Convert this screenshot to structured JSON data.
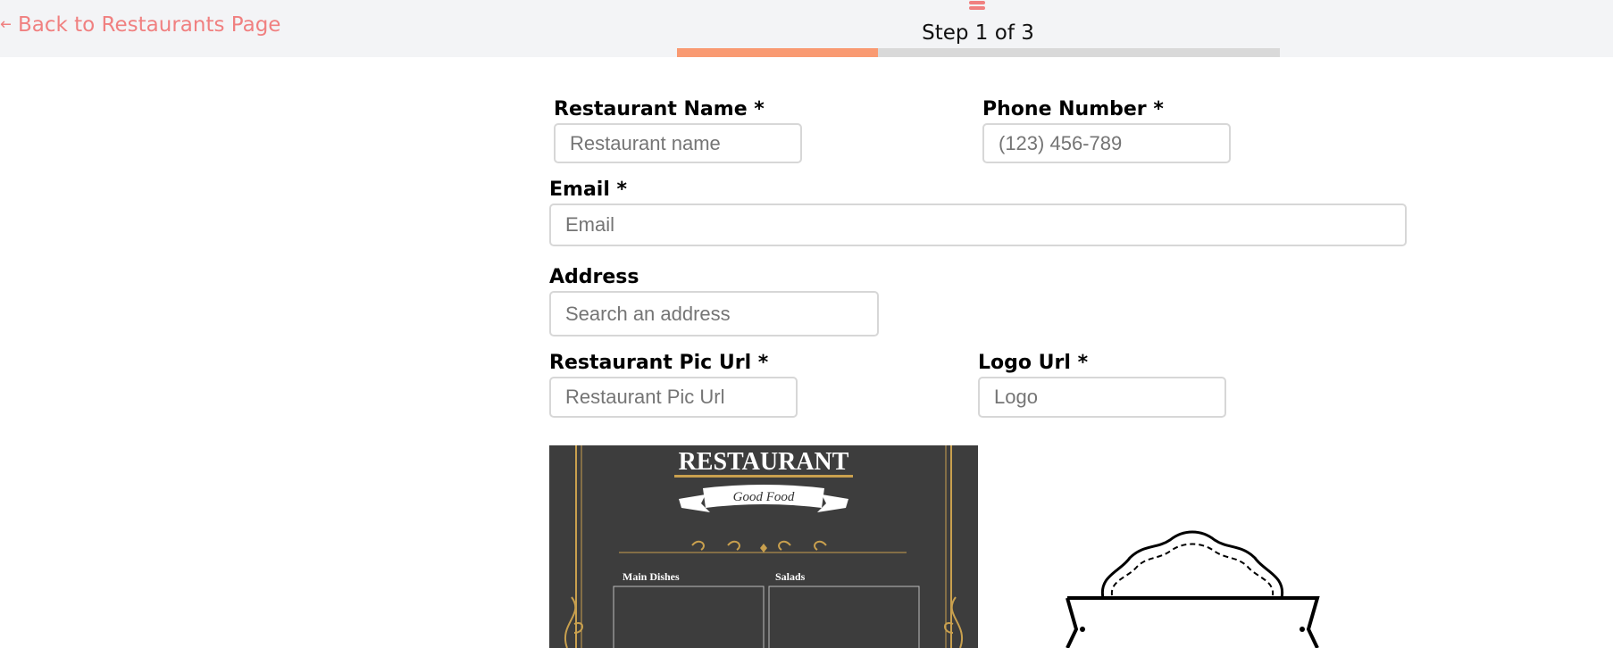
{
  "nav": {
    "back_label": "Back to Restaurants Page"
  },
  "progress": {
    "step_text": "Step 1 of 3",
    "fraction": 0.333
  },
  "form": {
    "name_label": "Restaurant Name *",
    "name_placeholder": "Restaurant name",
    "phone_label": "Phone Number *",
    "phone_placeholder": "(123) 456-789",
    "email_label": "Email *",
    "email_placeholder": "Email",
    "address_label": "Address",
    "address_placeholder": "Search an address",
    "pic_label": "Restaurant Pic Url *",
    "pic_placeholder": "Restaurant Pic Url",
    "logo_label": "Logo Url *",
    "logo_placeholder": "Logo"
  },
  "preview": {
    "menu_title": "RESTAURANT",
    "menu_banner": "Good Food",
    "menu_section_1": "Main Dishes",
    "menu_section_2": "Salads"
  },
  "colors": {
    "accent": "#f99a72",
    "link": "#f08080",
    "menu_gold": "#c9a04e",
    "menu_bg": "#3d3d3d"
  }
}
